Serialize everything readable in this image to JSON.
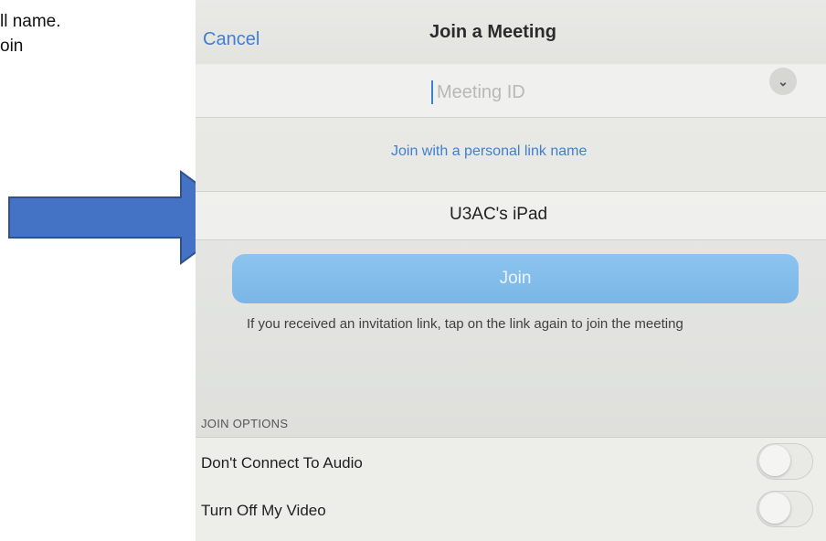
{
  "caption": {
    "line1": "ll name.",
    "line2": "oin"
  },
  "colors": {
    "accent": "#3f7fd3",
    "join_button": "#7ab6e6",
    "arrow_fill": "#4472c4",
    "arrow_stroke": "#2f528f"
  },
  "nav": {
    "cancel_label": "Cancel",
    "title": "Join a Meeting"
  },
  "meeting_id": {
    "placeholder": "Meeting ID",
    "dropdown_icon": "chevron-down-icon"
  },
  "personal_link": {
    "label": "Join with a personal link name"
  },
  "display_name": {
    "value": "U3AC's iPad"
  },
  "join_button": {
    "label": "Join"
  },
  "hint": {
    "text": "If you received an invitation link, tap on the link again to join the meeting"
  },
  "join_options": {
    "header": "JOIN OPTIONS",
    "items": [
      {
        "label": "Don't Connect To Audio",
        "enabled": false
      },
      {
        "label": "Turn Off My Video",
        "enabled": false
      }
    ]
  },
  "annotation": {
    "icon": "right-arrow-icon"
  }
}
